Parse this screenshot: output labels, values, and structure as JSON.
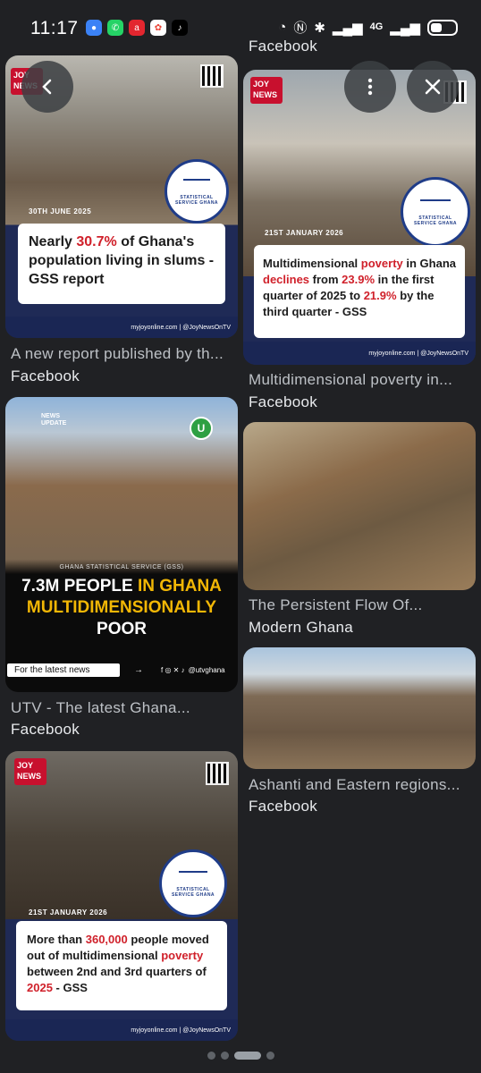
{
  "status_bar": {
    "time": "11:17",
    "app_icons": [
      "messages-icon",
      "whatsapp-icon",
      "airtel-icon",
      "photos-icon",
      "tiktok-icon"
    ],
    "network": "4G",
    "battery_level": 0.45
  },
  "top_partial_source": "Facebook",
  "overlay": {
    "back_icon": "back-arrow-icon",
    "more_icon": "more-vert-icon",
    "close_icon": "close-icon"
  },
  "results": [
    {
      "logo": "JOY NEWS",
      "date": "30TH JUNE 2025",
      "seal": "STATISTICAL SERVICE GHANA",
      "headline_parts": [
        "Nearly ",
        "30.7%",
        " of Ghana's population living in slums - GSS report"
      ],
      "footer": "myjoyonline.com | @JoyNewsOnTV",
      "title": "A new report published by th...",
      "source": "Facebook"
    },
    {
      "logo": "JOY NEWS",
      "date": "21ST JANUARY 2026",
      "seal": "STATISTICAL SERVICE GHANA",
      "headline_parts": [
        "Multidimensional ",
        "poverty",
        " in Ghana ",
        "declines",
        " from ",
        "23.9%",
        " in the first quarter of 2025 to ",
        "21.9%",
        " by the third quarter - GSS"
      ],
      "footer": "myjoyonline.com | @JoyNewsOnTV",
      "title": "Multidimensional poverty in...",
      "source": "Facebook"
    },
    {
      "badge": "NEWS UPDATE",
      "caption_small": "GHANA STATISTICAL SERVICE (GSS)",
      "headline_line1": "7.3M PEOPLE ",
      "headline_highlight": "IN GHANA MULTIDIMENSIONALLY",
      "headline_line3": "POOR",
      "cta": "For the latest news",
      "cta_arrow": "→",
      "handle": "@utvghana",
      "title": "UTV - The latest Ghana...",
      "source": "Facebook"
    },
    {
      "title": "The Persistent Flow Of...",
      "source": "Modern Ghana"
    },
    {
      "title": "Ashanti and Eastern regions...",
      "source": "Facebook"
    },
    {
      "logo": "JOY NEWS",
      "date": "21ST JANUARY 2026",
      "seal": "STATISTICAL SERVICE GHANA",
      "headline_parts": [
        "More than ",
        "360,000",
        " people moved out of multidimensional ",
        "poverty",
        " between 2nd and 3rd quarters of ",
        "2025",
        " - GSS"
      ],
      "footer": "myjoyonline.com | @JoyNewsOnTV"
    }
  ],
  "pager": {
    "pages": 4,
    "active": 2
  }
}
